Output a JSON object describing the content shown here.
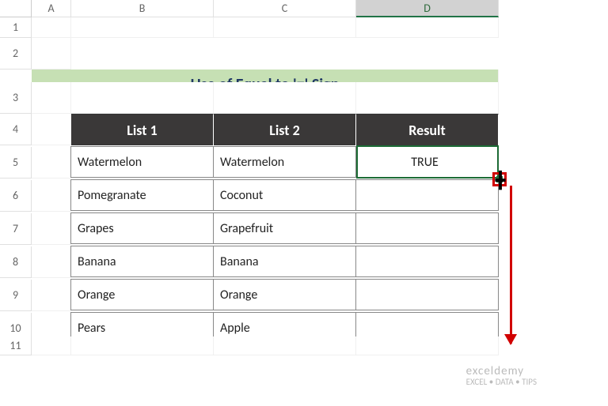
{
  "cols": [
    "A",
    "B",
    "C",
    "D"
  ],
  "rows": [
    "1",
    "2",
    "3",
    "4",
    "5",
    "6",
    "7",
    "8",
    "9",
    "10",
    "11"
  ],
  "title": "Use of Equal to '=' Sign",
  "headers": {
    "b": "List 1",
    "c": "List 2",
    "d": "Result"
  },
  "data": [
    {
      "b": "Watermelon",
      "c": "Watermelon",
      "d": "TRUE"
    },
    {
      "b": "Pomegranate",
      "c": "Coconut",
      "d": ""
    },
    {
      "b": "Grapes",
      "c": "Grapefruit",
      "d": ""
    },
    {
      "b": "Banana",
      "c": "Banana",
      "d": ""
    },
    {
      "b": "Orange",
      "c": "Orange",
      "d": ""
    },
    {
      "b": "Pears",
      "c": "Apple",
      "d": ""
    }
  ],
  "watermark": {
    "brand": "exceldemy",
    "tag": "EXCEL • DATA • TIPS"
  },
  "selected_col": "D"
}
